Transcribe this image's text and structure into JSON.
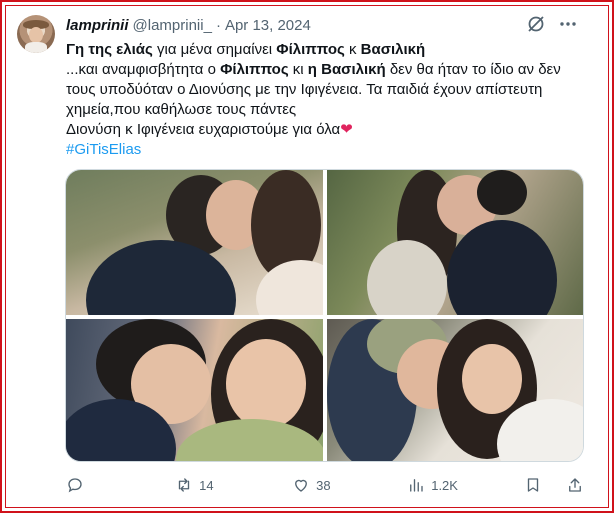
{
  "tweet": {
    "display_name": "lamprinii",
    "handle": "@lamprinii_",
    "separator": "·",
    "date": "Apr 13, 2024",
    "line1": {
      "t1": "Γη της ελιάς",
      "t2": " για μένα σημαίνει ",
      "t3": "Φίλιππος",
      "t4": " κ ",
      "t5": "Βασιλική"
    },
    "line2": {
      "t1": "...και αναμφισβήτητα ο ",
      "t2": "Φίλιππος",
      "t3": " κι ",
      "t4": "η Βασιλική",
      "t5": " δεν θα ήταν το ίδιο αν δεν τους υποδύόταν ο Διονύσης με την Ιφιγένεια. Τα παιδιά έχουν απίστευτη χημεία,που καθήλωσε τους πάντες"
    },
    "line3": "Διονύση κ Ιφιγένεια ευχαριστούμε για όλα",
    "hashtag": "#GiTisElias"
  },
  "actions": {
    "replies": "",
    "retweets": "14",
    "likes": "38",
    "views": "1.2K"
  },
  "icons": {
    "grok": "grok-icon",
    "more": "more-icon",
    "reply": "reply-icon",
    "retweet": "retweet-icon",
    "like": "like-icon",
    "views": "views-icon",
    "bookmark": "bookmark-icon",
    "share": "share-icon"
  },
  "colors": {
    "frame": "#d0121b",
    "hashtag": "#1d9bf0",
    "muted": "#536471",
    "heart": "#e0245e"
  }
}
